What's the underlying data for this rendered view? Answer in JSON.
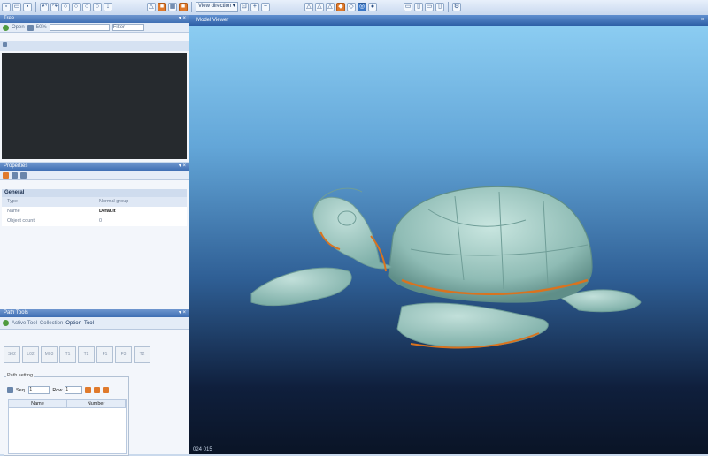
{
  "toolbar": {
    "view_direction_label": "View direction"
  },
  "tree_panel": {
    "title": "Tree",
    "open_label": "Open",
    "scale_label": "50%",
    "filter_value": "Filter"
  },
  "properties_panel": {
    "title": "Properties",
    "group": "General",
    "rows": [
      {
        "key": "Type",
        "value": "Normal group"
      },
      {
        "key": "Name",
        "value": "Default"
      },
      {
        "key": "Object count",
        "value": "0"
      }
    ]
  },
  "path_panel": {
    "title": "Path Tools",
    "btn_active": "Active Tool",
    "btn_collection": "Collection",
    "btn_option": "Option",
    "btn_tool": "Tool",
    "steps": [
      "S02",
      "L02",
      "M03",
      "T1",
      "T2",
      "F1",
      "F3",
      "T2"
    ],
    "setting_label": "Path setting",
    "seq_label": "Seq.",
    "seq_value": "1",
    "row_label": "Row",
    "row_value": "1",
    "col_name": "Name",
    "col_number": "Number"
  },
  "viewer": {
    "title": "Model Viewer",
    "status": "024 015"
  },
  "colors": {
    "accent": "#3f6fb3",
    "model": "#9fc9c2",
    "highlight": "#d9731f"
  }
}
